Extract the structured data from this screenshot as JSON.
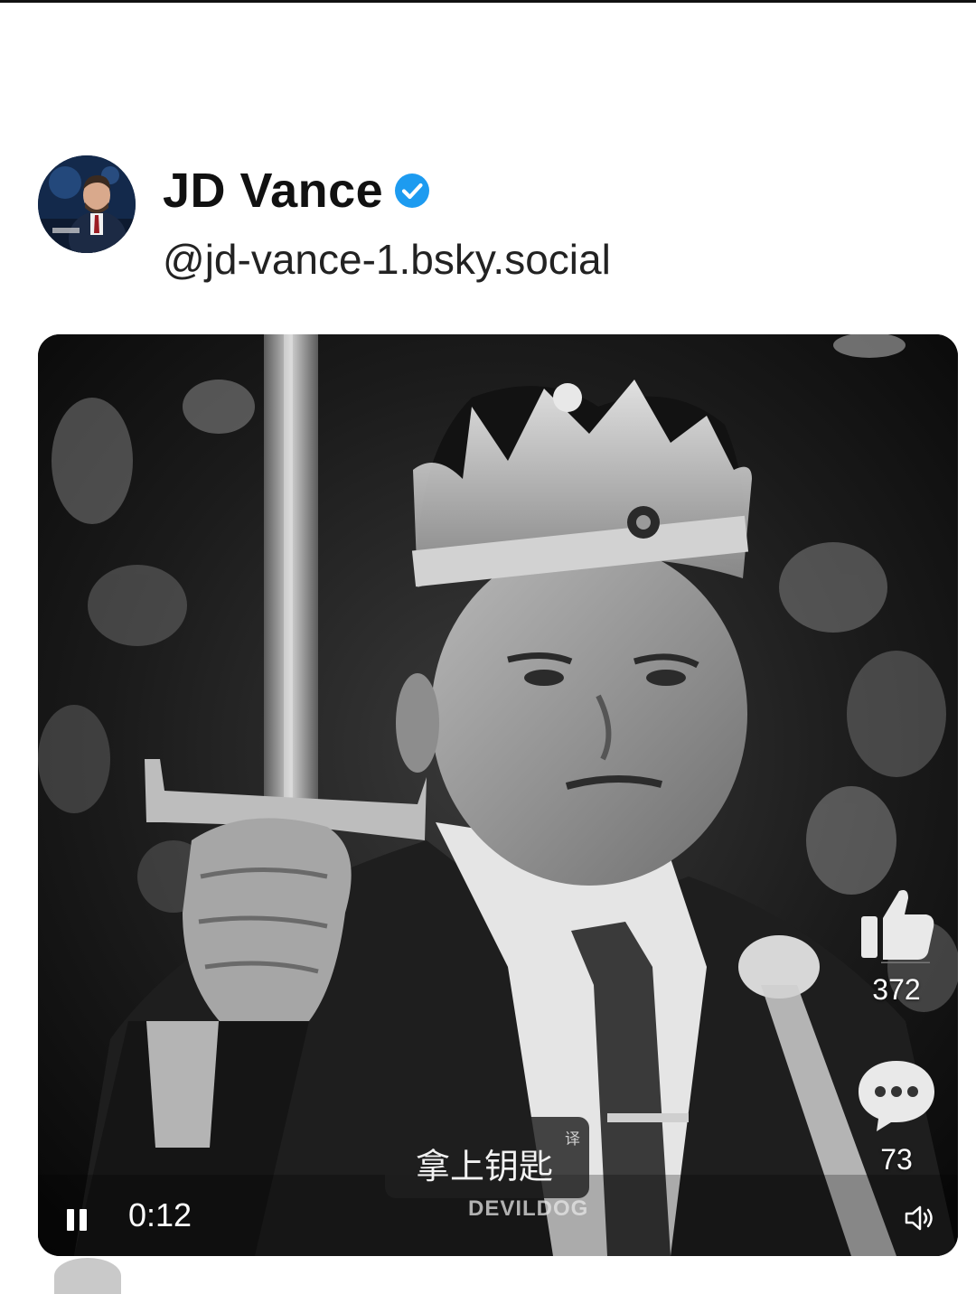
{
  "post": {
    "author": {
      "display_name": "JD Vance",
      "handle": "@jd-vance-1.bsky.social",
      "verified": true,
      "verified_color": "#1d9bf0"
    },
    "video": {
      "elapsed_time": "0:12",
      "playback_state": "playing",
      "subtitle": "拿上钥匙",
      "subtitle_badge": "译",
      "watermark": "DEVILDOG",
      "likes": "372",
      "comments": "73"
    }
  },
  "icons": [
    "verified-check-icon",
    "thumbs-up-icon",
    "comment-bubble-icon",
    "pause-icon",
    "volume-icon"
  ]
}
